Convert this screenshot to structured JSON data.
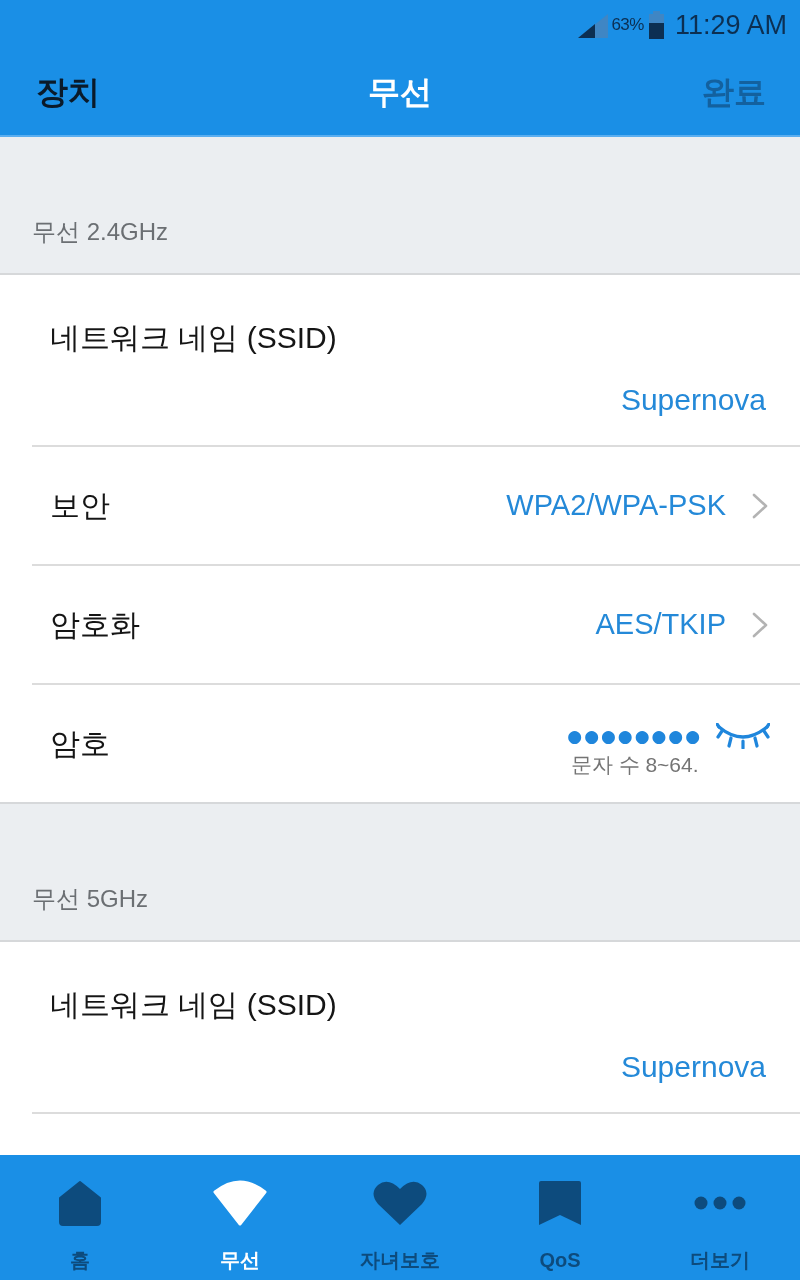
{
  "status_bar": {
    "battery_percent": "63%",
    "time": "11:29 AM"
  },
  "header": {
    "back_label": "장치",
    "title": "무선",
    "done": {
      "label": "완료",
      "disabled": true
    }
  },
  "sections": [
    {
      "title": "무선 2.4GHz",
      "rows": [
        {
          "kind": "text_field",
          "label": "네트워크 네임 (SSID)",
          "value": "Supernova"
        },
        {
          "kind": "picker",
          "label": "보안",
          "value": "WPA2/WPA-PSK"
        },
        {
          "kind": "picker",
          "label": "암호화",
          "value": "AES/TKIP"
        },
        {
          "kind": "password",
          "label": "암호",
          "value": "●●●●●●●●",
          "hint": "문자 수 8~64."
        }
      ]
    },
    {
      "title": "무선 5GHz",
      "rows": [
        {
          "kind": "text_field",
          "label": "네트워크 네임 (SSID)",
          "value": "Supernova"
        }
      ]
    }
  ],
  "tab_bar": [
    {
      "label": "홈",
      "selected": false
    },
    {
      "label": "무선",
      "selected": true
    },
    {
      "label": "자녀보호",
      "selected": false
    },
    {
      "label": "QoS",
      "selected": false
    },
    {
      "label": "더보기",
      "selected": false
    }
  ]
}
